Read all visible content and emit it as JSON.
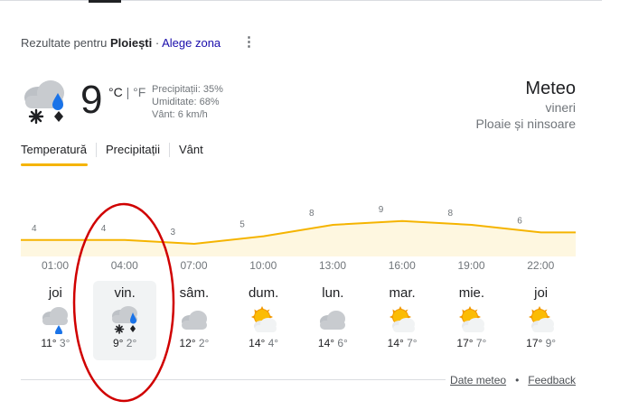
{
  "location": {
    "prefix": "Rezultate pentru ",
    "name": "Ploiești",
    "separator": " · ",
    "change": "Alege zona"
  },
  "current": {
    "temp": "9",
    "unit_c": "°C",
    "unit_sep": " | ",
    "unit_f": "°F",
    "precip": "Precipitații: 35%",
    "humidity": "Umiditate: 68%",
    "wind": "Vânt: 6 km/h",
    "icon": "cloud-rain-snow-icon"
  },
  "header": {
    "title": "Meteo",
    "day": "vineri",
    "condition": "Ploaie și ninsoare"
  },
  "tabs": [
    "Temperatură",
    "Precipitații",
    "Vânt"
  ],
  "chart_data": {
    "type": "area",
    "x": [
      "01:00",
      "04:00",
      "07:00",
      "10:00",
      "13:00",
      "16:00",
      "19:00",
      "22:00"
    ],
    "values": [
      4,
      4,
      3,
      5,
      8,
      9,
      8,
      6
    ],
    "color": "#f5b400",
    "fill": "#fef7e0"
  },
  "days": [
    {
      "name": "joi",
      "hi": "11°",
      "lo": "3°",
      "icon": "rain-icon"
    },
    {
      "name": "vin.",
      "hi": "9°",
      "lo": "2°",
      "icon": "rain-snow-icon",
      "selected": true
    },
    {
      "name": "sâm.",
      "hi": "12°",
      "lo": "2°",
      "icon": "cloud-icon"
    },
    {
      "name": "dum.",
      "hi": "14°",
      "lo": "4°",
      "icon": "partly-cloudy-icon"
    },
    {
      "name": "lun.",
      "hi": "14°",
      "lo": "6°",
      "icon": "cloud-icon"
    },
    {
      "name": "mar.",
      "hi": "14°",
      "lo": "7°",
      "icon": "partly-cloudy-icon"
    },
    {
      "name": "mie.",
      "hi": "17°",
      "lo": "7°",
      "icon": "partly-cloudy-icon"
    },
    {
      "name": "joi",
      "hi": "17°",
      "lo": "9°",
      "icon": "partly-cloudy-icon"
    }
  ],
  "footer": {
    "data": "Date meteo",
    "sep": "•",
    "feedback": "Feedback"
  },
  "colors": {
    "accent": "#f5b400",
    "link": "#1a0dab",
    "annotation": "#d00000"
  }
}
